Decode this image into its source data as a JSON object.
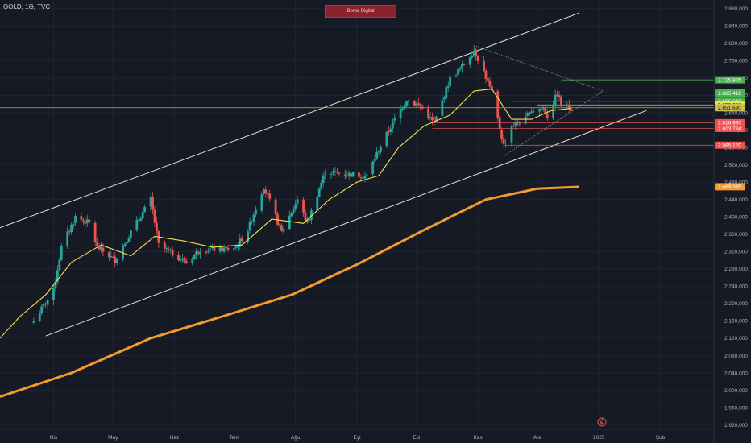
{
  "header": {
    "symbol": "GOLD, 1G, TVC",
    "banner": "Borsa Digital"
  },
  "colors": {
    "background": "#161a25",
    "grid": "#1f2431",
    "up": "#26a69a",
    "down": "#ef5350",
    "ma_short": "#f5e050",
    "ma_long": "#f59a2c",
    "channel": "#e8e4c8"
  },
  "chart_data": {
    "type": "candlestick",
    "symbol": "GOLD",
    "interval": "1G",
    "source": "TVC",
    "y_axis": {
      "min": 1910,
      "max": 2900,
      "ticks": [
        1920,
        1960,
        2000,
        2040,
        2080,
        2120,
        2160,
        2200,
        2240,
        2280,
        2320,
        2360,
        2400,
        2440,
        2480,
        2520,
        2560,
        2600,
        2640,
        2680,
        2720,
        2760,
        2800,
        2840,
        2880
      ],
      "tick_labels": [
        "1.920,000",
        "1.960,000",
        "2.000,000",
        "2.040,000",
        "2.080,000",
        "2.120,000",
        "2.160,000",
        "2.200,000",
        "2.240,000",
        "2.280,000",
        "2.320,000",
        "2.360,000",
        "2.400,000",
        "2.440,000",
        "2.480,000",
        "2.520,000",
        "2.560,000",
        "2.600,000",
        "2.640,000",
        "2.680,000",
        "2.720,000",
        "2.760,000",
        "2.800,000",
        "2.840,000",
        "2.880,000"
      ]
    },
    "x_axis": {
      "labels": [
        "Nis",
        "May",
        "Haz",
        "Tem",
        "Ağu",
        "Eyl",
        "Eki",
        "Kas",
        "Ara",
        "2025",
        "Şub"
      ],
      "label_dates": [
        "2024-04-01",
        "2024-05-01",
        "2024-06-01",
        "2024-07-01",
        "2024-08-01",
        "2024-09-01",
        "2024-10-01",
        "2024-11-01",
        "2024-12-01",
        "2025-01-01",
        "2025-02-01"
      ]
    },
    "price_keypoints": [
      [
        "2024-03-22",
        2160
      ],
      [
        "2024-04-01",
        2230
      ],
      [
        "2024-04-05",
        2330
      ],
      [
        "2024-04-12",
        2400
      ],
      [
        "2024-04-19",
        2385
      ],
      [
        "2024-04-23",
        2330
      ],
      [
        "2024-05-02",
        2300
      ],
      [
        "2024-05-10",
        2365
      ],
      [
        "2024-05-20",
        2440
      ],
      [
        "2024-05-24",
        2335
      ],
      [
        "2024-06-07",
        2295
      ],
      [
        "2024-06-14",
        2325
      ],
      [
        "2024-06-28",
        2325
      ],
      [
        "2024-07-02",
        2330
      ],
      [
        "2024-07-08",
        2370
      ],
      [
        "2024-07-16",
        2470
      ],
      [
        "2024-07-25",
        2365
      ],
      [
        "2024-08-02",
        2440
      ],
      [
        "2024-08-07",
        2385
      ],
      [
        "2024-08-16",
        2505
      ],
      [
        "2024-08-23",
        2500
      ],
      [
        "2024-09-06",
        2495
      ],
      [
        "2024-09-12",
        2555
      ],
      [
        "2024-09-20",
        2625
      ],
      [
        "2024-09-26",
        2670
      ],
      [
        "2024-10-03",
        2655
      ],
      [
        "2024-10-10",
        2615
      ],
      [
        "2024-10-18",
        2720
      ],
      [
        "2024-10-23",
        2740
      ],
      [
        "2024-10-30",
        2785
      ],
      [
        "2024-11-04",
        2735
      ],
      [
        "2024-11-08",
        2685
      ],
      [
        "2024-11-14",
        2565
      ],
      [
        "2024-11-18",
        2610
      ],
      [
        "2024-11-25",
        2625
      ],
      [
        "2024-11-27",
        2645
      ],
      [
        "2024-12-04",
        2650
      ],
      [
        "2024-12-06",
        2632
      ],
      [
        "2024-12-11",
        2685
      ],
      [
        "2024-12-13",
        2658
      ],
      [
        "2024-12-18",
        2651
      ]
    ],
    "moving_average_short": {
      "color": "#f5e050",
      "points": [
        [
          "2024-03-05",
          2120
        ],
        [
          "2024-03-15",
          2170
        ],
        [
          "2024-03-28",
          2220
        ],
        [
          "2024-04-10",
          2295
        ],
        [
          "2024-04-25",
          2335
        ],
        [
          "2024-05-10",
          2310
        ],
        [
          "2024-05-22",
          2355
        ],
        [
          "2024-06-05",
          2345
        ],
        [
          "2024-06-20",
          2330
        ],
        [
          "2024-07-05",
          2335
        ],
        [
          "2024-07-20",
          2395
        ],
        [
          "2024-08-05",
          2385
        ],
        [
          "2024-08-18",
          2440
        ],
        [
          "2024-09-01",
          2480
        ],
        [
          "2024-09-12",
          2495
        ],
        [
          "2024-09-22",
          2560
        ],
        [
          "2024-10-05",
          2610
        ],
        [
          "2024-10-18",
          2635
        ],
        [
          "2024-10-30",
          2690
        ],
        [
          "2024-11-08",
          2695
        ],
        [
          "2024-11-18",
          2625
        ],
        [
          "2024-11-28",
          2625
        ],
        [
          "2024-12-08",
          2645
        ],
        [
          "2024-12-18",
          2650
        ]
      ]
    },
    "moving_average_long": {
      "color": "#f59a2c",
      "points": [
        [
          "2024-03-05",
          1985
        ],
        [
          "2024-04-10",
          2040
        ],
        [
          "2024-05-20",
          2120
        ],
        [
          "2024-06-25",
          2170
        ],
        [
          "2024-07-30",
          2220
        ],
        [
          "2024-09-01",
          2290
        ],
        [
          "2024-10-05",
          2370
        ],
        [
          "2024-11-05",
          2440
        ],
        [
          "2024-12-01",
          2465
        ],
        [
          "2024-12-22",
          2469
        ]
      ]
    },
    "trend_channel": {
      "upper": [
        [
          "2024-03-05",
          2375
        ],
        [
          "2024-12-22",
          2870
        ]
      ],
      "lower": [
        [
          "2024-03-28",
          2125
        ],
        [
          "2025-01-25",
          2645
        ]
      ]
    },
    "triangle": {
      "top": [
        [
          "2024-10-30",
          2795
        ],
        [
          "2025-01-03",
          2690
        ]
      ],
      "bottom": [
        [
          "2024-11-14",
          2540
        ],
        [
          "2025-01-03",
          2690
        ]
      ]
    },
    "levels": [
      {
        "value": 2715.805,
        "label": "2.715,805",
        "color": "#4caf50",
        "start": "2024-12-13"
      },
      {
        "value": 2685.418,
        "label": "2.685,418",
        "color": "#4caf50",
        "start": "2024-11-18"
      },
      {
        "value": 2666.34,
        "label": "2.666,340",
        "color": "#4caf50",
        "start": "2024-11-18"
      },
      {
        "value": 2658.081,
        "label": "2.658,081",
        "color": "#f0e040",
        "start": "2024-12-01"
      },
      {
        "value": 2651.63,
        "label": "2.651,630",
        "color": "#c8c050",
        "start": "2024-03-05"
      },
      {
        "value": 2616.98,
        "label": "2.616,980",
        "color": "#ef5350",
        "start": "2024-10-09"
      },
      {
        "value": 2603.784,
        "label": "2.603,784",
        "color": "#ef5350",
        "start": "2024-10-09"
      },
      {
        "value": 2565.12,
        "label": "2.565,120",
        "color": "#ef5350",
        "start": "2024-11-14"
      },
      {
        "value": 2469.335,
        "label": "2.469,335",
        "color": "#f59a2c",
        "start": null
      }
    ]
  }
}
